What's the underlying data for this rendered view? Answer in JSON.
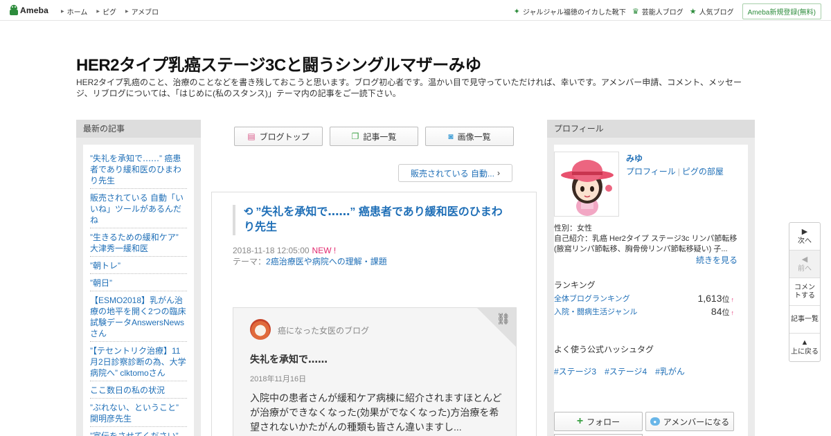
{
  "topbar": {
    "logo_text": "Ameba",
    "nav": [
      "ホーム",
      "ピグ",
      "アメブロ"
    ],
    "right_items": [
      {
        "icon": "star-icon",
        "label": "ジャルジャル福徳のイカした靴下"
      },
      {
        "icon": "crown-icon",
        "label": "芸能人ブログ"
      },
      {
        "icon": "star-icon",
        "label": "人気ブログ"
      }
    ],
    "register_label": "Ameba新規登録(無料)"
  },
  "header": {
    "title": "HER2タイプ乳癌ステージ3Cと闘うシングルマザーみゆ",
    "description": "HER2タイプ乳癌のこと、治療のことなどを書き残しておこうと思います。ブログ初心者です。温かい目で見守っていただければ、幸いです。アメンバー申請、コメント、メッセージ、リブログについては、「はじめに(私のスタンス)」テーマ内の記事をご一読下さい。"
  },
  "left": {
    "heading": "最新の記事",
    "items": [
      "”失礼を承知で‥‥‥” 癌患者であり緩和医のひまわり先生",
      "販売されている 自動「いいね」ツールがあるんだね",
      "”生きるための緩和ケア” 大津秀一緩和医",
      "”朝トレ”",
      "”朝日”",
      "【ESMO2018】乳がん治療の地平を開く2つの臨床試験データAnswersNewsさん",
      "”【テセントリク治療】11月2日診察診断の為、大学病院へ” clktomoさん",
      "ここ数日の私の状況",
      "”ぶれない、ということ” 関明彦先生",
      "”宣伝をさせてください” 広島大学病院 乳腺外科"
    ]
  },
  "center": {
    "nav_buttons": [
      {
        "icon": "document-icon",
        "label": "ブログトップ"
      },
      {
        "icon": "copy-icon",
        "label": "記事一覧"
      },
      {
        "icon": "camera-icon",
        "label": "画像一覧"
      }
    ],
    "next_entry": "販売されている 自動...",
    "article": {
      "title": "”失礼を承知で‥‥‥” 癌患者であり緩和医のひまわり先生",
      "datetime": "2018-11-18 12:05:00",
      "new_label": "NEW !",
      "theme_prefix": "テーマ：",
      "theme": "2癌治療医や病院への理解・課題"
    },
    "reblog": {
      "blog_name": "癌になった女医のブログ",
      "title": "失礼を承知で‥‥‥",
      "date": "2018年11月16日",
      "body": "入院中の患者さんが緩和ケア病棟に紹介されますほとんどが治療ができなくなった(効果がでなくなった)方治療を希望されないかたがんの種類も皆さん違いますし..."
    }
  },
  "right": {
    "heading": "プロフィール",
    "name": "みゆ",
    "link_profile": "プロフィール",
    "link_pig": "ピグの部屋",
    "info": "性別：女性\n自己紹介：乳癌 Her2タイプ ステージ3c リンパ節転移 (腋窩リンパ節転移、胸骨傍リンパ節転移疑い) 子...",
    "more": "続きを見る",
    "ranking_heading": "ランキング",
    "rankings": [
      {
        "label": "全体ブログランキング",
        "value": "1,613",
        "unit": "位",
        "arrow": "↑"
      },
      {
        "label": "入院・闘病生活ジャンル",
        "value": "84",
        "unit": "位",
        "arrow": "↑"
      }
    ],
    "hashtag_heading": "よく使う公式ハッシュタグ",
    "hashtags": [
      "#ステージ3",
      "#ステージ4",
      "#乳がん"
    ],
    "follow_label": "フォロー",
    "amember_label": "アメンバーになる"
  },
  "sidenav": {
    "next": "次へ",
    "prev": "前へ",
    "comment": "コメントする",
    "list": "記事一覧",
    "top": "上に戻る"
  },
  "colors": {
    "link": "#1f6fb7",
    "accent_green": "#2d8c3c",
    "new_badge": "#e2286e"
  }
}
